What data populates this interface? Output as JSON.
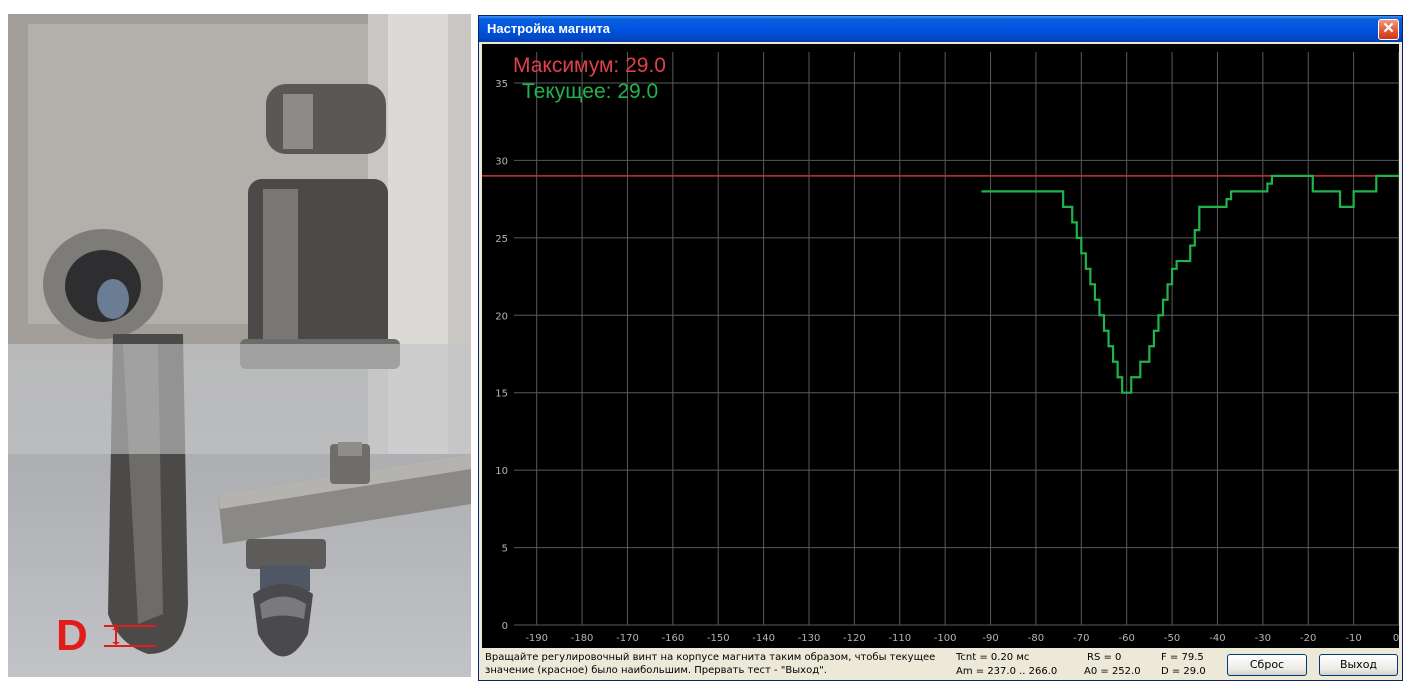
{
  "photo": {
    "label": "D"
  },
  "window": {
    "title": "Настройка магнита",
    "close_glyph": "✕"
  },
  "legend": {
    "max": "Максимум: 29.0",
    "current": "Текущее: 29.0"
  },
  "chart_data": {
    "type": "line",
    "xlim": [
      -195,
      0
    ],
    "ylim": [
      0,
      37
    ],
    "grid": true,
    "x_ticks": [
      -190,
      -180,
      -170,
      -160,
      -150,
      -140,
      -130,
      -120,
      -110,
      -100,
      -90,
      -80,
      -70,
      -60,
      -50,
      -40,
      -30,
      -20,
      -10,
      0
    ],
    "y_ticks": [
      0,
      5,
      10,
      15,
      20,
      25,
      30,
      35
    ],
    "max_line": 29.0,
    "series": [
      {
        "color": "#21b34a",
        "x": [
          -92,
          -76,
          -74,
          -73,
          -72,
          -71,
          -70,
          -69,
          -68,
          -67,
          -66,
          -65,
          -64,
          -63,
          -62,
          -61,
          -60,
          -59,
          -58,
          -57,
          -56,
          -55,
          -54,
          -53,
          -52,
          -51,
          -50,
          -49,
          -48,
          -47,
          -46,
          -45,
          -44,
          -43,
          -42,
          -41,
          -40,
          -39,
          -38,
          -37,
          -36,
          -35,
          -34,
          -33,
          -32,
          -31,
          -30,
          -29,
          -28,
          -27,
          -26,
          -25,
          -24,
          -23,
          -22,
          -21,
          -20,
          -19,
          -18,
          -17,
          -16,
          -15,
          -14,
          -13,
          -12,
          -11,
          -10,
          -9,
          -8,
          -7,
          -6,
          -5,
          -4,
          -3,
          -2,
          -1,
          0
        ],
        "y": [
          28,
          28,
          27,
          27,
          26,
          25,
          24,
          23,
          22,
          21,
          20,
          19,
          18,
          17,
          16,
          15,
          15,
          16,
          16,
          17,
          17,
          18,
          19,
          20,
          21,
          22,
          23,
          23.5,
          23.5,
          23.5,
          24.5,
          25.5,
          27,
          27,
          27,
          27,
          27,
          27,
          27.5,
          28,
          28,
          28,
          28,
          28,
          28,
          28,
          28,
          28.5,
          29,
          29,
          29,
          29,
          29,
          29,
          29,
          29,
          29,
          28,
          28,
          28,
          28,
          28,
          28,
          27,
          27,
          27,
          28,
          28,
          28,
          28,
          28,
          29,
          29,
          29,
          29,
          29,
          29
        ]
      }
    ]
  },
  "status": {
    "hint": "Вращайте регулировочный винт на корпусе магнита таким образом, чтобы текущее значение (красное) было наибольшим. Прервать тест - \"Выход\".",
    "tcnt": "Tcnt = 0.20 мс",
    "am": "Am = 237.0 .. 266.0",
    "rs": "RS = 0",
    "a0": "A0 = 252.0",
    "f": "F = 79.5",
    "d": "D = 29.0"
  },
  "buttons": {
    "reset": "Сброс",
    "exit": "Выход"
  }
}
